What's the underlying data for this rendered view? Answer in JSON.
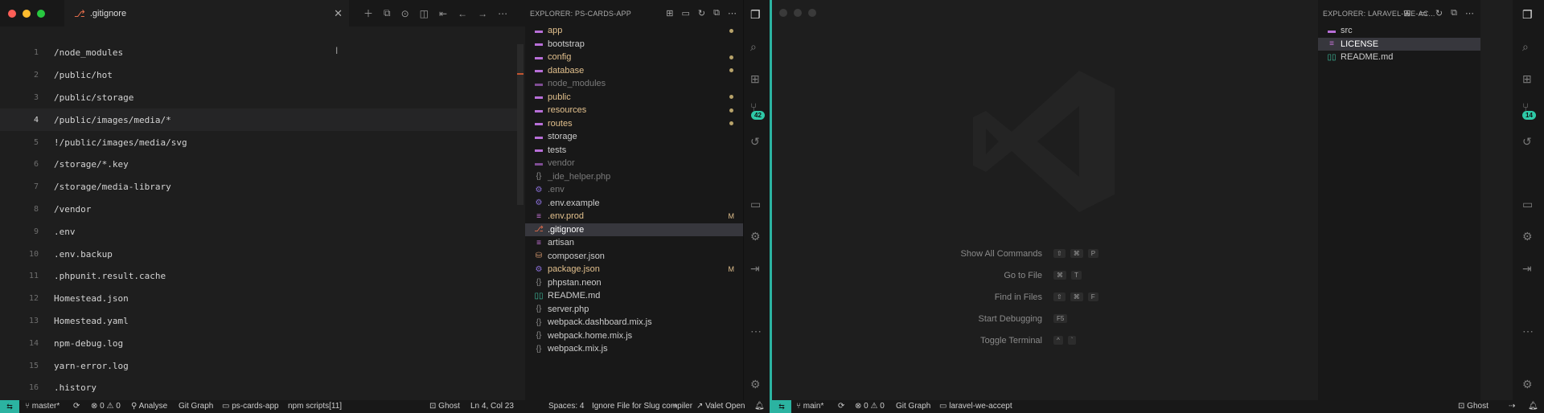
{
  "win1": {
    "tab": {
      "name": ".gitignore"
    },
    "editor": {
      "lines": [
        {
          "n": "1",
          "text": "/node_modules"
        },
        {
          "n": "2",
          "text": "/public/hot"
        },
        {
          "n": "3",
          "text": "/public/storage"
        },
        {
          "n": "4",
          "text": "/public/images/media/*"
        },
        {
          "n": "5",
          "text": "!/public/images/media/svg"
        },
        {
          "n": "6",
          "text": "/storage/*.key"
        },
        {
          "n": "7",
          "text": "/storage/media-library"
        },
        {
          "n": "8",
          "text": "/vendor"
        },
        {
          "n": "9",
          "text": ".env"
        },
        {
          "n": "10",
          "text": ".env.backup"
        },
        {
          "n": "11",
          "text": ".phpunit.result.cache"
        },
        {
          "n": "12",
          "text": "Homestead.json"
        },
        {
          "n": "13",
          "text": "Homestead.yaml"
        },
        {
          "n": "14",
          "text": "npm-debug.log"
        },
        {
          "n": "15",
          "text": "yarn-error.log"
        },
        {
          "n": "16",
          "text": ".history"
        }
      ]
    },
    "explorer": {
      "title": "EXPLORER: PS-CARDS-APP",
      "items": [
        {
          "name": "app",
          "color": "#e2c08d",
          "icon": "folder-icon",
          "iconColor": "#b86fd8",
          "mark": "dot"
        },
        {
          "name": "bootstrap",
          "color": "#cccccc",
          "icon": "folder-icon",
          "iconColor": "#b86fd8",
          "mark": ""
        },
        {
          "name": "config",
          "color": "#e2c08d",
          "icon": "folder-icon",
          "iconColor": "#b86fd8",
          "mark": "dot"
        },
        {
          "name": "database",
          "color": "#e2c08d",
          "icon": "folder-icon",
          "iconColor": "#b86fd8",
          "mark": "dot"
        },
        {
          "name": "node_modules",
          "color": "#7a7a7a",
          "icon": "folder-icon",
          "iconColor": "#7f4d94",
          "mark": ""
        },
        {
          "name": "public",
          "color": "#e2c08d",
          "icon": "folder-icon",
          "iconColor": "#b86fd8",
          "mark": "dot"
        },
        {
          "name": "resources",
          "color": "#e2c08d",
          "icon": "folder-icon",
          "iconColor": "#b86fd8",
          "mark": "dot"
        },
        {
          "name": "routes",
          "color": "#e2c08d",
          "icon": "folder-icon",
          "iconColor": "#b86fd8",
          "mark": "dot"
        },
        {
          "name": "storage",
          "color": "#cccccc",
          "icon": "folder-icon",
          "iconColor": "#b86fd8",
          "mark": ""
        },
        {
          "name": "tests",
          "color": "#cccccc",
          "icon": "folder-icon",
          "iconColor": "#b86fd8",
          "mark": ""
        },
        {
          "name": "vendor",
          "color": "#7a7a7a",
          "icon": "folder-icon",
          "iconColor": "#7f4d94",
          "mark": ""
        },
        {
          "name": "_ide_helper.php",
          "color": "#7a7a7a",
          "icon": "braces-icon",
          "iconColor": "#8a8a8a",
          "mark": ""
        },
        {
          "name": ".env",
          "color": "#7a7a7a",
          "icon": "gear-icon",
          "iconColor": "#8a6fd8",
          "mark": ""
        },
        {
          "name": ".env.example",
          "color": "#cccccc",
          "icon": "gear-icon",
          "iconColor": "#8a6fd8",
          "mark": ""
        },
        {
          "name": ".env.prod",
          "color": "#e2c08d",
          "icon": "lines-icon",
          "iconColor": "#c675d8",
          "mark": "M"
        },
        {
          "name": ".gitignore",
          "color": "#ffffff",
          "icon": "git-icon",
          "iconColor": "#e06c4a",
          "mark": "",
          "selected": true
        },
        {
          "name": "artisan",
          "color": "#cccccc",
          "icon": "lines-icon",
          "iconColor": "#c675d8",
          "mark": ""
        },
        {
          "name": "composer.json",
          "color": "#cccccc",
          "icon": "database-icon",
          "iconColor": "#d89a6f",
          "mark": ""
        },
        {
          "name": "package.json",
          "color": "#e2c08d",
          "icon": "gear-icon",
          "iconColor": "#8a6fd8",
          "mark": "M"
        },
        {
          "name": "phpstan.neon",
          "color": "#cccccc",
          "icon": "braces-icon",
          "iconColor": "#8a8a8a",
          "mark": ""
        },
        {
          "name": "README.md",
          "color": "#cccccc",
          "icon": "book-icon",
          "iconColor": "#3fbf9f",
          "mark": ""
        },
        {
          "name": "server.php",
          "color": "#cccccc",
          "icon": "braces-icon",
          "iconColor": "#8a8a8a",
          "mark": ""
        },
        {
          "name": "webpack.dashboard.mix.js",
          "color": "#cccccc",
          "icon": "braces-icon",
          "iconColor": "#8a8a8a",
          "mark": ""
        },
        {
          "name": "webpack.home.mix.js",
          "color": "#cccccc",
          "icon": "braces-icon",
          "iconColor": "#8a8a8a",
          "mark": ""
        },
        {
          "name": "webpack.mix.js",
          "color": "#cccccc",
          "icon": "braces-icon",
          "iconColor": "#8a8a8a",
          "mark": ""
        }
      ]
    },
    "activity_badge": "42",
    "status": {
      "branch": "master*",
      "problems": "0 ⚠ 0",
      "analyse": "Analyse",
      "git_graph": "Git Graph",
      "folder": "ps-cards-app",
      "npm": "npm scripts[11]",
      "ghost": "Ghost",
      "position": "Ln 4, Col 23",
      "spaces": "Spaces: 4",
      "language": "Ignore File for Slug compiler",
      "valet": "Valet Open"
    }
  },
  "win2": {
    "explorer": {
      "title": "EXPLORER: LARAVEL-WE-AC...",
      "items": [
        {
          "name": "src",
          "color": "#cccccc",
          "icon": "folder-icon",
          "iconColor": "#b86fd8"
        },
        {
          "name": "LICENSE",
          "color": "#ffffff",
          "icon": "lines-icon",
          "iconColor": "#c675d8",
          "selected": true
        },
        {
          "name": "README.md",
          "color": "#cccccc",
          "icon": "book-icon",
          "iconColor": "#3fbf9f"
        }
      ]
    },
    "activity_badge": "14",
    "shortcuts": [
      {
        "label": "Show All Commands",
        "keys": [
          "⇧",
          "⌘",
          "P"
        ]
      },
      {
        "label": "Go to File",
        "keys": [
          "⌘",
          "T"
        ]
      },
      {
        "label": "Find in Files",
        "keys": [
          "⇧",
          "⌘",
          "F"
        ]
      },
      {
        "label": "Start Debugging",
        "keys": [
          "F5"
        ]
      },
      {
        "label": "Toggle Terminal",
        "keys": [
          "^",
          "`"
        ]
      }
    ],
    "status": {
      "branch": "main*",
      "problems": "0 ⚠ 0",
      "git_graph": "Git Graph",
      "folder": "laravel-we-accept",
      "ghost": "Ghost"
    }
  }
}
